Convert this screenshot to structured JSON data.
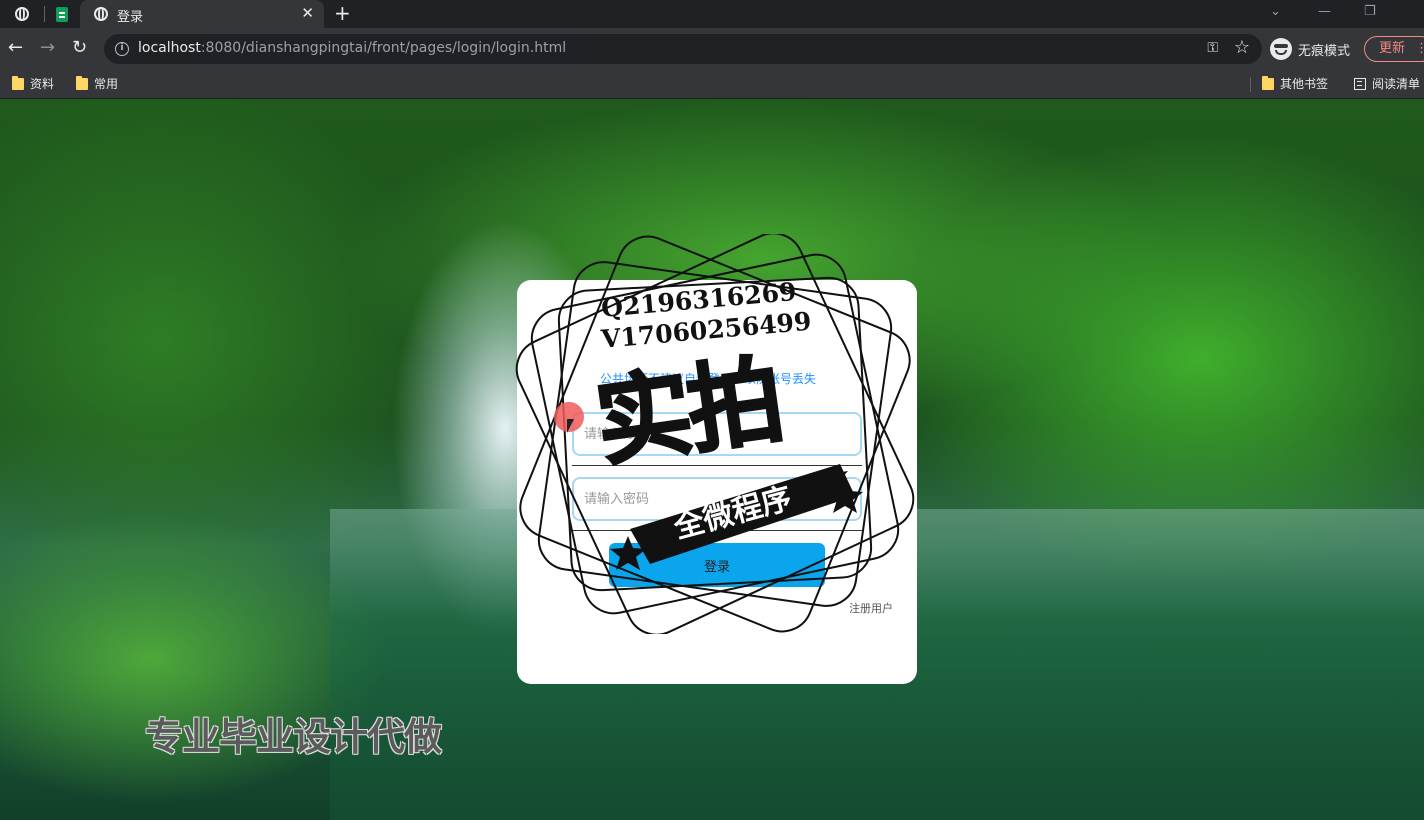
{
  "browser": {
    "active_tab": {
      "title": "登录"
    },
    "url": {
      "host": "localhost",
      "rest": ":8080/dianshangpingtai/front/pages/login/login.html"
    },
    "incognito_label": "无痕模式",
    "update_label": "更新",
    "bookmarks": [
      {
        "label": "资料",
        "icon": "folder-icon"
      },
      {
        "label": "常用",
        "icon": "folder-icon"
      }
    ],
    "other_bookmarks": "其他书签",
    "reading_list": "阅读清单"
  },
  "login": {
    "tip": "公共场所不建议自动登录，以防账号丢失",
    "username_placeholder": "请输入账号",
    "password_placeholder": "请输入密码",
    "login_button": "登录",
    "register_link": "注册用户"
  },
  "overlay": {
    "qq": "Q2196316269",
    "wechat": "V17060256499",
    "big_text": "实拍",
    "ribbon_text": "全微程序",
    "caption": "专业毕业设计代做"
  },
  "colors": {
    "accent": "#0aa5ec",
    "tip_text": "#1e90ff",
    "update": "#f28b82"
  }
}
